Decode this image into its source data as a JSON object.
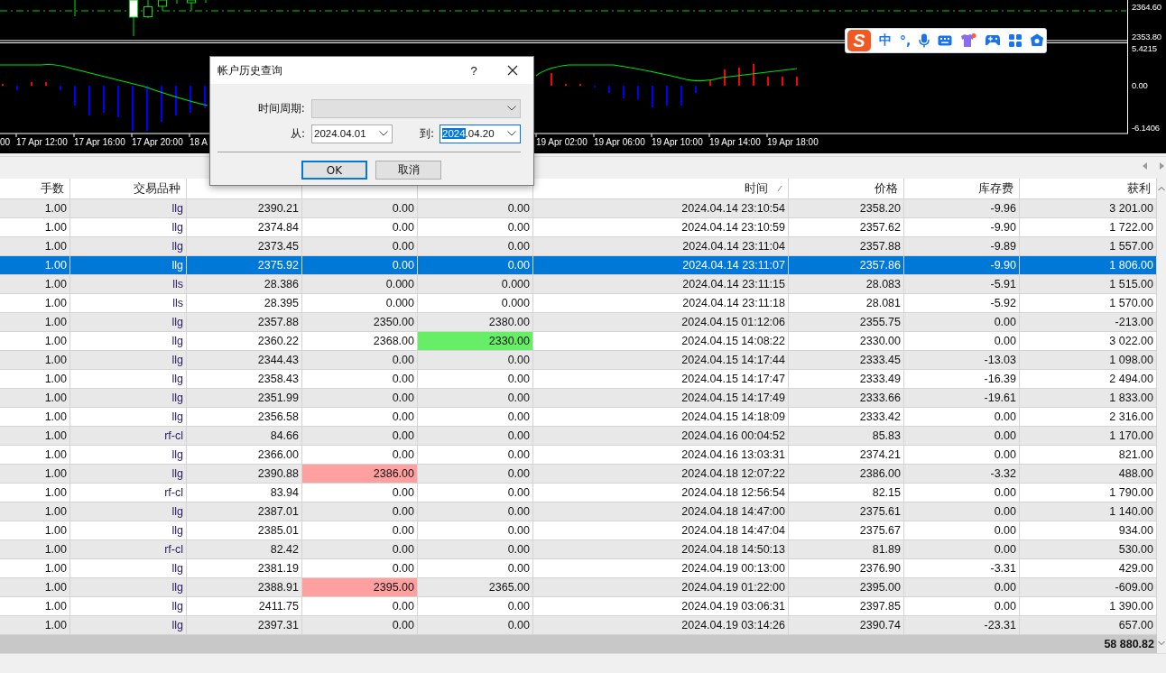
{
  "chart": {
    "price_labels": [
      "2364.60",
      "2353.80"
    ],
    "indicator_labels": [
      "5.4215",
      "0.00",
      "-6.1406"
    ],
    "time_labels": [
      "00",
      "17 Apr 12:00",
      "17 Apr 16:00",
      "17 Apr 20:00",
      "18 A",
      "19 Apr 02:00",
      "19 Apr 06:00",
      "19 Apr 10:00",
      "19 Apr 14:00",
      "19 Apr 18:00"
    ]
  },
  "ime_toolbar": {
    "logo": "S",
    "mode": "中",
    "punctuation": "°,"
  },
  "dialog": {
    "title": "帐户历史查询",
    "help": "?",
    "period_label": "时间周期:",
    "period_disabled": true,
    "from_label": "从:",
    "from_value": "2024.04.01",
    "to_label": "到:",
    "to_value_selected": "2024",
    "to_value_rest": ".04.20",
    "buttons": [
      {
        "label": "OK",
        "default": true
      },
      {
        "label": "取消",
        "default": false
      }
    ]
  },
  "table": {
    "columns": [
      {
        "label": "手数",
        "sorted": false
      },
      {
        "label": "交易品种",
        "sorted": false
      },
      {
        "sorted": false
      },
      {
        "sorted": false
      },
      {
        "sorted": false
      },
      {
        "label": "时间",
        "sorted": true
      },
      {
        "label": "价格",
        "sorted": false
      },
      {
        "label": "库存费",
        "sorted": false
      },
      {
        "label": "获利",
        "sorted": false
      }
    ],
    "rows": [
      {
        "lots": "1.00",
        "symbol": "llg",
        "price": "2390.21",
        "sl": "0.00",
        "tp": "0.00",
        "time": "2024.04.14 23:10:54",
        "close_price": "2358.20",
        "swap": "-9.96",
        "profit": "3 201.00",
        "selected": false
      },
      {
        "lots": "1.00",
        "symbol": "llg",
        "price": "2374.84",
        "sl": "0.00",
        "tp": "0.00",
        "time": "2024.04.14 23:10:59",
        "close_price": "2357.62",
        "swap": "-9.90",
        "profit": "1 722.00",
        "selected": false
      },
      {
        "lots": "1.00",
        "symbol": "llg",
        "price": "2373.45",
        "sl": "0.00",
        "tp": "0.00",
        "time": "2024.04.14 23:11:04",
        "close_price": "2357.88",
        "swap": "-9.89",
        "profit": "1 557.00",
        "selected": false
      },
      {
        "lots": "1.00",
        "symbol": "llg",
        "price": "2375.92",
        "sl": "0.00",
        "tp": "0.00",
        "time": "2024.04.14 23:11:07",
        "close_price": "2357.86",
        "swap": "-9.90",
        "profit": "1 806.00",
        "selected": true
      },
      {
        "lots": "1.00",
        "symbol": "lls",
        "price": "28.386",
        "sl": "0.000",
        "tp": "0.000",
        "time": "2024.04.14 23:11:15",
        "close_price": "28.083",
        "swap": "-5.91",
        "profit": "1 515.00",
        "selected": false
      },
      {
        "lots": "1.00",
        "symbol": "lls",
        "price": "28.395",
        "sl": "0.000",
        "tp": "0.000",
        "time": "2024.04.14 23:11:18",
        "close_price": "28.081",
        "swap": "-5.92",
        "profit": "1 570.00",
        "selected": false
      },
      {
        "lots": "1.00",
        "symbol": "llg",
        "price": "2357.88",
        "sl": "2350.00",
        "tp": "2380.00",
        "time": "2024.04.15 01:12:06",
        "close_price": "2355.75",
        "swap": "0.00",
        "profit": "-213.00",
        "selected": false
      },
      {
        "lots": "1.00",
        "symbol": "llg",
        "price": "2360.22",
        "sl": "2368.00",
        "tp": {
          "value": "2330.00",
          "color": "#66ee66"
        },
        "time": "2024.04.15 14:08:22",
        "close_price": "2330.00",
        "swap": "0.00",
        "profit": "3 022.00",
        "selected": false
      },
      {
        "lots": "1.00",
        "symbol": "llg",
        "price": "2344.43",
        "sl": "0.00",
        "tp": "0.00",
        "time": "2024.04.15 14:17:44",
        "close_price": "2333.45",
        "swap": "-13.03",
        "profit": "1 098.00",
        "selected": false
      },
      {
        "lots": "1.00",
        "symbol": "llg",
        "price": "2358.43",
        "sl": "0.00",
        "tp": "0.00",
        "time": "2024.04.15 14:17:47",
        "close_price": "2333.49",
        "swap": "-16.39",
        "profit": "2 494.00",
        "selected": false
      },
      {
        "lots": "1.00",
        "symbol": "llg",
        "price": "2351.99",
        "sl": "0.00",
        "tp": "0.00",
        "time": "2024.04.15 14:17:49",
        "close_price": "2333.66",
        "swap": "-19.61",
        "profit": "1 833.00",
        "selected": false
      },
      {
        "lots": "1.00",
        "symbol": "llg",
        "price": "2356.58",
        "sl": "0.00",
        "tp": "0.00",
        "time": "2024.04.15 14:18:09",
        "close_price": "2333.42",
        "swap": "0.00",
        "profit": "2 316.00",
        "selected": false
      },
      {
        "lots": "1.00",
        "symbol": "rf-cl",
        "price": "84.66",
        "sl": "0.00",
        "tp": "0.00",
        "time": "2024.04.16 00:04:52",
        "close_price": "85.83",
        "swap": "0.00",
        "profit": "1 170.00",
        "selected": false
      },
      {
        "lots": "1.00",
        "symbol": "llg",
        "price": "2366.00",
        "sl": "0.00",
        "tp": "0.00",
        "time": "2024.04.16 13:03:31",
        "close_price": "2374.21",
        "swap": "0.00",
        "profit": "821.00",
        "selected": false
      },
      {
        "lots": "1.00",
        "symbol": "llg",
        "price": "2390.88",
        "sl": {
          "value": "2386.00",
          "color": "#ffa0a0"
        },
        "tp": "0.00",
        "time": "2024.04.18 12:07:22",
        "close_price": "2386.00",
        "swap": "-3.32",
        "profit": "488.00",
        "selected": false
      },
      {
        "lots": "1.00",
        "symbol": "rf-cl",
        "price": "83.94",
        "sl": "0.00",
        "tp": "0.00",
        "time": "2024.04.18 12:56:54",
        "close_price": "82.15",
        "swap": "0.00",
        "profit": "1 790.00",
        "selected": false
      },
      {
        "lots": "1.00",
        "symbol": "llg",
        "price": "2387.01",
        "sl": "0.00",
        "tp": "0.00",
        "time": "2024.04.18 14:47:00",
        "close_price": "2375.61",
        "swap": "0.00",
        "profit": "1 140.00",
        "selected": false
      },
      {
        "lots": "1.00",
        "symbol": "llg",
        "price": "2385.01",
        "sl": "0.00",
        "tp": "0.00",
        "time": "2024.04.18 14:47:04",
        "close_price": "2375.67",
        "swap": "0.00",
        "profit": "934.00",
        "selected": false
      },
      {
        "lots": "1.00",
        "symbol": "rf-cl",
        "price": "82.42",
        "sl": "0.00",
        "tp": "0.00",
        "time": "2024.04.18 14:50:13",
        "close_price": "81.89",
        "swap": "0.00",
        "profit": "530.00",
        "selected": false
      },
      {
        "lots": "1.00",
        "symbol": "llg",
        "price": "2381.19",
        "sl": "0.00",
        "tp": "0.00",
        "time": "2024.04.19 00:13:00",
        "close_price": "2376.90",
        "swap": "-3.31",
        "profit": "429.00",
        "selected": false
      },
      {
        "lots": "1.00",
        "symbol": "llg",
        "price": "2388.91",
        "sl": {
          "value": "2395.00",
          "color": "#ffa0a0"
        },
        "tp": "2365.00",
        "time": "2024.04.19 01:22:00",
        "close_price": "2395.00",
        "swap": "0.00",
        "profit": "-609.00",
        "selected": false
      },
      {
        "lots": "1.00",
        "symbol": "llg",
        "price": "2411.75",
        "sl": "0.00",
        "tp": "0.00",
        "time": "2024.04.19 03:06:31",
        "close_price": "2397.85",
        "swap": "0.00",
        "profit": "1 390.00",
        "selected": false
      },
      {
        "lots": "1.00",
        "symbol": "llg",
        "price": "2397.31",
        "sl": "0.00",
        "tp": "0.00",
        "time": "2024.04.19 03:14:26",
        "close_price": "2390.74",
        "swap": "-23.31",
        "profit": "657.00",
        "selected": false
      }
    ],
    "total": "58 880.82"
  }
}
